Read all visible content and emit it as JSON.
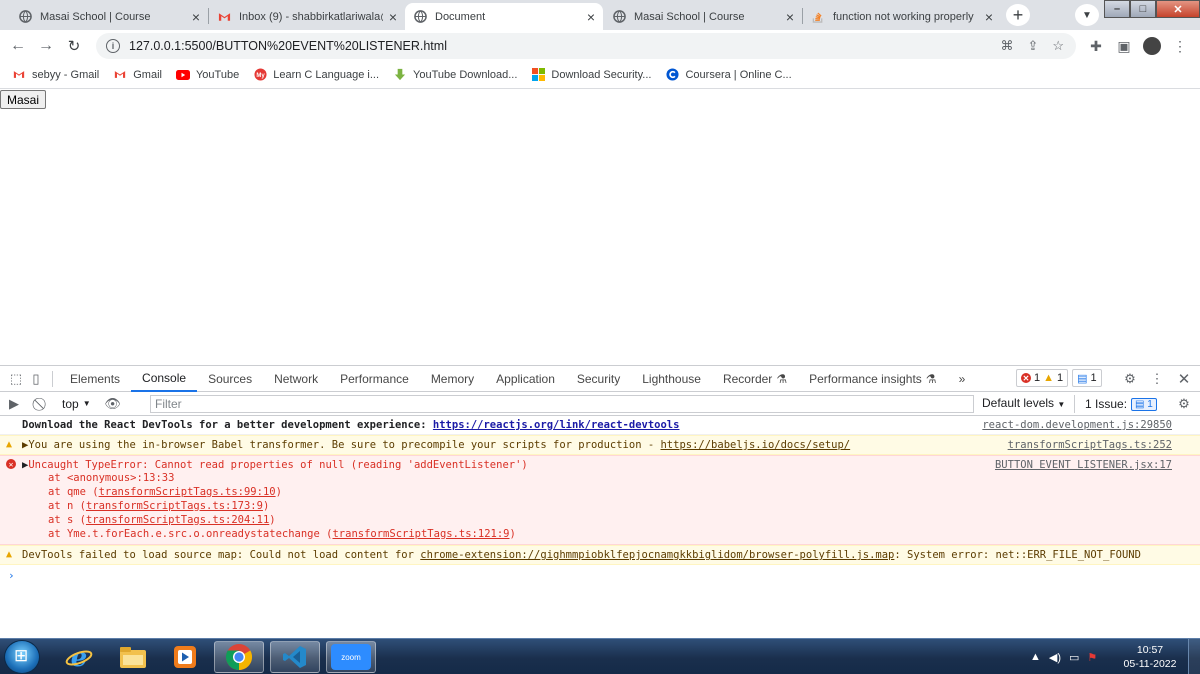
{
  "browser": {
    "tabs": [
      {
        "title": "Masai School | Course",
        "icon": "globe-icon",
        "active": false
      },
      {
        "title": "Inbox (9) - shabbirkatlariwala@",
        "icon": "gmail-icon",
        "active": false
      },
      {
        "title": "Document",
        "icon": "globe-icon",
        "active": true
      },
      {
        "title": "Masai School | Course",
        "icon": "globe-icon",
        "active": false
      },
      {
        "title": "function not working properly",
        "icon": "stackoverflow-icon",
        "active": false
      }
    ],
    "url": "127.0.0.1:5500/BUTTON%20EVENT%20LISTENER.html",
    "bookmarks": [
      {
        "label": "sebyy - Gmail",
        "icon": "gmail-icon"
      },
      {
        "label": "Gmail",
        "icon": "gmail-icon"
      },
      {
        "label": "YouTube",
        "icon": "youtube-icon"
      },
      {
        "label": "Learn C Language i...",
        "icon": "my-icon"
      },
      {
        "label": "YouTube Download...",
        "icon": "download-arrow-icon"
      },
      {
        "label": "Download Security...",
        "icon": "microsoft-icon"
      },
      {
        "label": "Coursera | Online C...",
        "icon": "coursera-icon"
      }
    ]
  },
  "page": {
    "button_label": "Masai"
  },
  "devtools": {
    "tabs": [
      "Elements",
      "Console",
      "Sources",
      "Network",
      "Performance",
      "Memory",
      "Application",
      "Security",
      "Lighthouse",
      "Recorder",
      "Performance insights"
    ],
    "active_tab": "Console",
    "error_count": "1",
    "warning_count": "1",
    "message_count": "1",
    "context": "top",
    "filter_placeholder": "Filter",
    "levels": "Default levels",
    "issues_label": "1 Issue:",
    "issues_count": "1",
    "messages": {
      "m1_text": "Download the React DevTools for a better development experience: ",
      "m1_link": "https://reactjs.org/link/react-devtools",
      "m1_src": "react-dom.development.js:29850",
      "m2_text": "You are using the in-browser Babel transformer. Be sure to precompile your scripts for production - ",
      "m2_link": "https://babeljs.io/docs/setup/",
      "m2_src": "transformScriptTags.ts:252",
      "m3_text": "Uncaught TypeError: Cannot read properties of null (reading 'addEventListener')",
      "m3_src": "BUTTON EVENT LISTENER.jsx:17",
      "m3_stack1": "at <anonymous>:13:33",
      "m3_stack2_pre": "at qme (",
      "m3_stack2_link": "transformScriptTags.ts:99:10",
      "m3_stack3_pre": "at n (",
      "m3_stack3_link": "transformScriptTags.ts:173:9",
      "m3_stack4_pre": "at s (",
      "m3_stack4_link": "transformScriptTags.ts:204:11",
      "m3_stack5_pre": "at Yme.t.forEach.e.src.o.onreadystatechange (",
      "m3_stack5_link": "transformScriptTags.ts:121:9",
      "m4_text": "DevTools failed to load source map: Could not load content for ",
      "m4_link": "chrome-extension://gighmmpiobklfepjocnamgkkbiglidom/browser-polyfill.js.map",
      "m4_tail": ": System error: net::ERR_FILE_NOT_FOUND"
    }
  },
  "taskbar": {
    "apps": [
      "start-orb",
      "internet-explorer-icon",
      "file-explorer-icon",
      "media-player-icon",
      "chrome-icon",
      "vscode-icon",
      "zoom-icon"
    ],
    "zoom_label": "zoom",
    "time": "10:57",
    "date": "05-11-2022"
  }
}
